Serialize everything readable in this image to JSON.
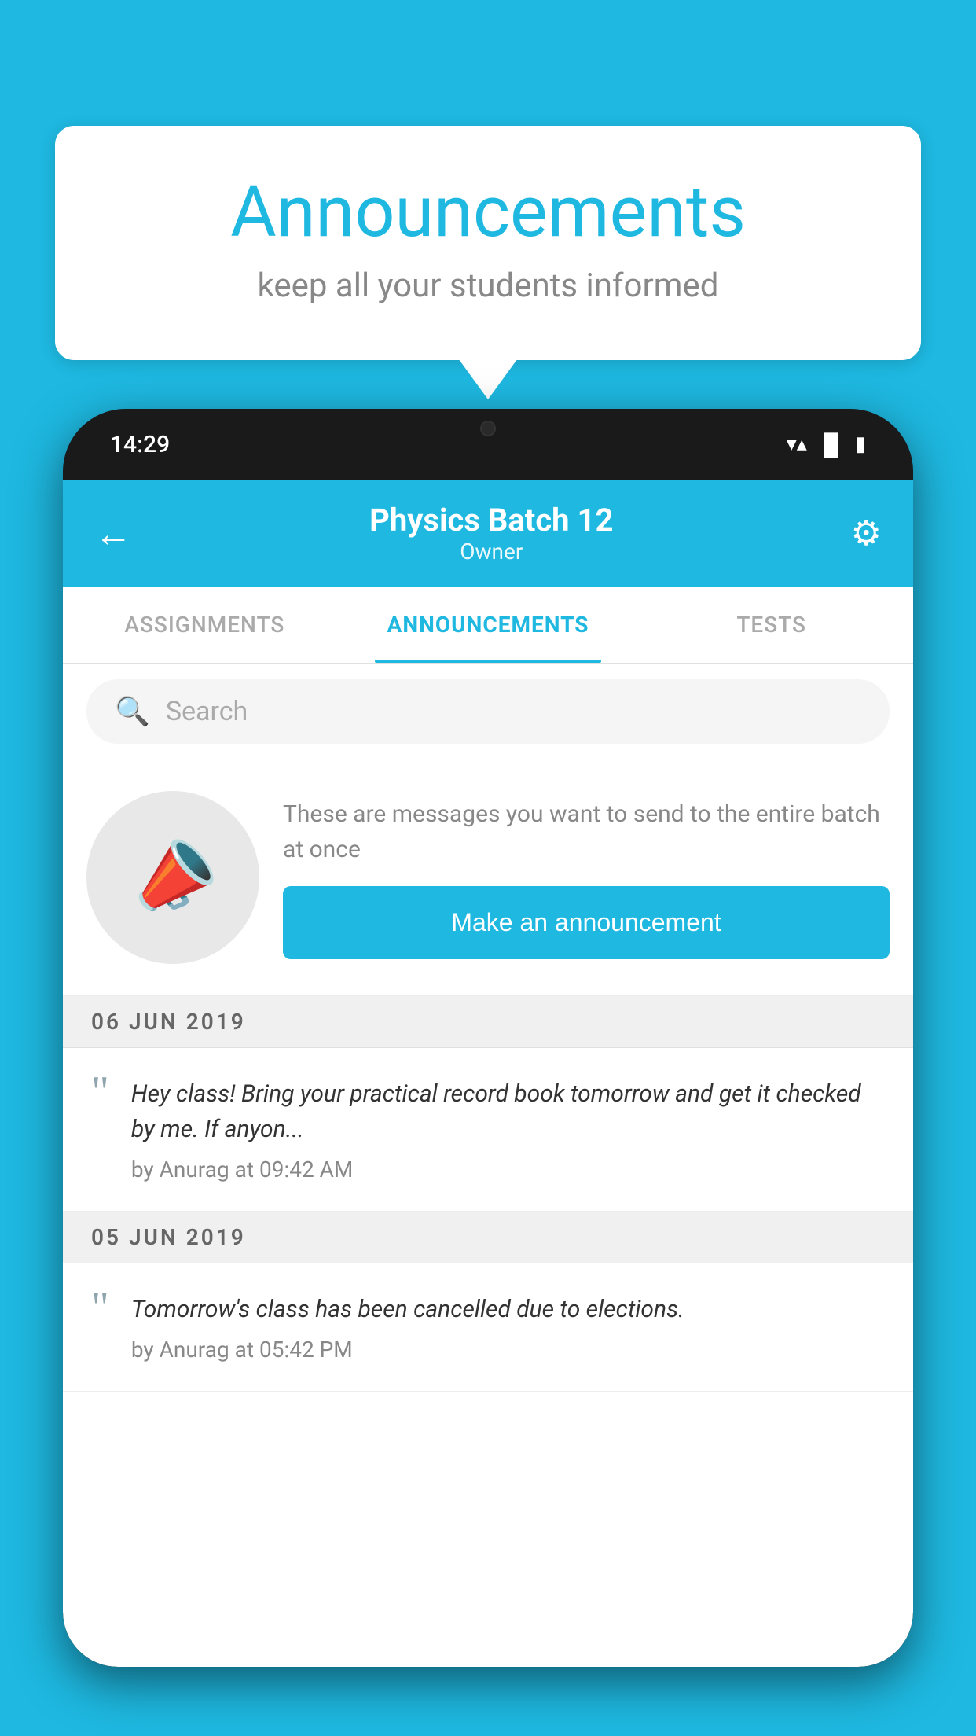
{
  "background_color": "#1eb8e0",
  "speech_bubble": {
    "title": "Announcements",
    "subtitle": "keep all your students informed"
  },
  "phone": {
    "status_bar": {
      "time": "14:29",
      "icons": [
        "▼",
        "▲",
        "▌"
      ]
    },
    "header": {
      "title": "Physics Batch 12",
      "subtitle": "Owner",
      "back_label": "←",
      "gear_label": "⚙"
    },
    "tabs": [
      {
        "label": "ASSIGNMENTS",
        "active": false
      },
      {
        "label": "ANNOUNCEMENTS",
        "active": true
      },
      {
        "label": "TESTS",
        "active": false
      }
    ],
    "search": {
      "placeholder": "Search"
    },
    "promo": {
      "description": "These are messages you want to send to the entire batch at once",
      "button_label": "Make an announcement"
    },
    "announcements": [
      {
        "date": "06  JUN  2019",
        "text": "Hey class! Bring your practical record book tomorrow and get it checked by me. If anyon...",
        "author": "by Anurag at 09:42 AM"
      },
      {
        "date": "05  JUN  2019",
        "text": "Tomorrow's class has been cancelled due to elections.",
        "author": "by Anurag at 05:42 PM"
      }
    ]
  }
}
